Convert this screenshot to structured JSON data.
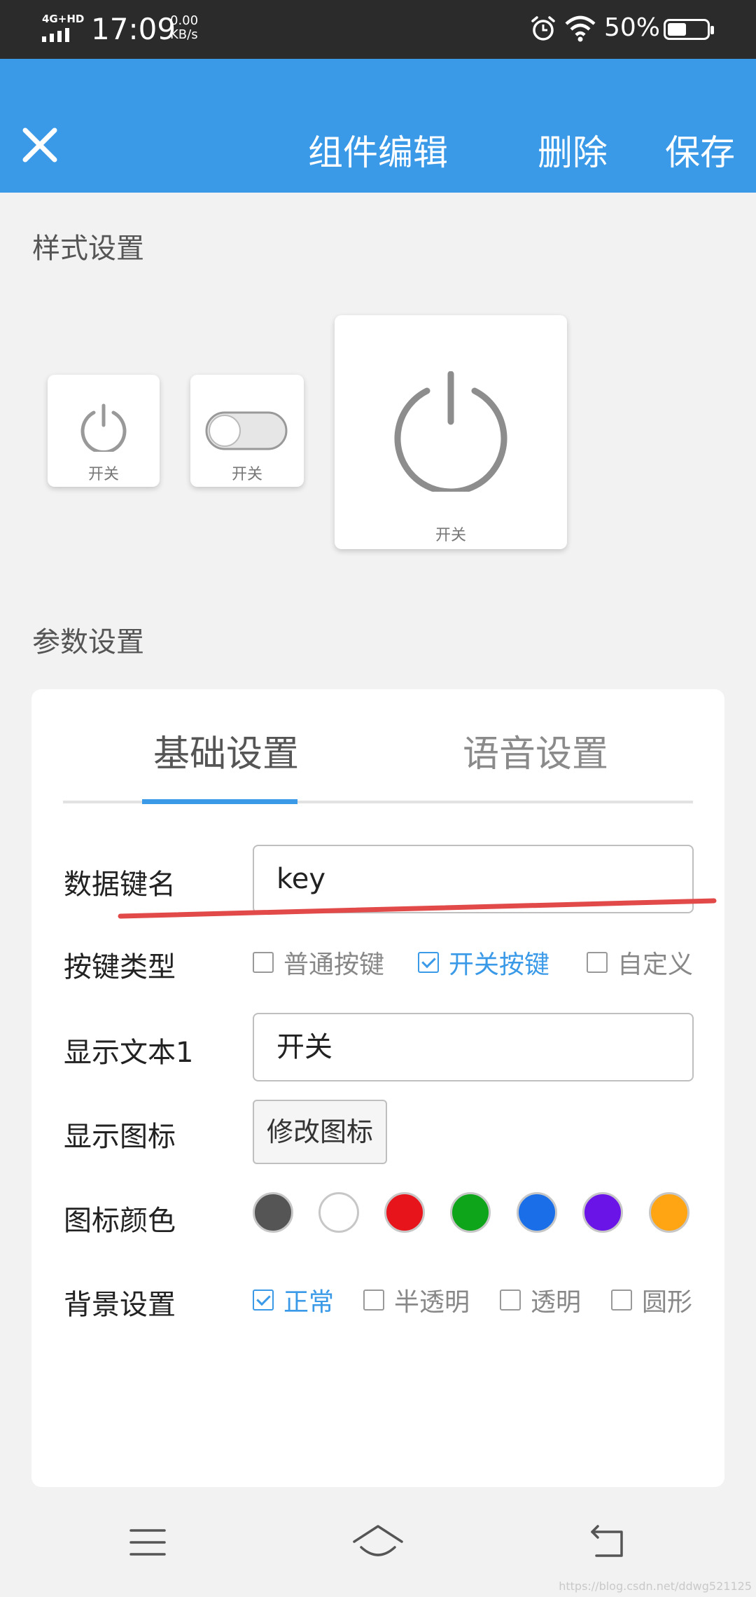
{
  "status_bar": {
    "network": "4G+HD",
    "time": "17:09",
    "speed_value": "0.00",
    "speed_unit": "KB/s",
    "battery_text": "50%",
    "battery_level": 0.5
  },
  "app_bar": {
    "close_icon": "close-icon",
    "title": "组件编辑",
    "delete_label": "删除",
    "save_label": "保存",
    "color": "#3a9ae8"
  },
  "style_section": {
    "title": "样式设置",
    "options": [
      {
        "icon": "power-icon",
        "caption": "开关"
      },
      {
        "icon": "toggle-switch-icon",
        "caption": "开关"
      },
      {
        "icon": "power-icon",
        "caption": "开关"
      }
    ]
  },
  "param_section": {
    "title": "参数设置",
    "tabs": [
      {
        "label": "基础设置",
        "active": true
      },
      {
        "label": "语音设置",
        "active": false
      }
    ],
    "data_key": {
      "label": "数据键名",
      "value": "key"
    },
    "key_type": {
      "label": "按键类型",
      "options": [
        {
          "label": "普通按键",
          "checked": false
        },
        {
          "label": "开关按键",
          "checked": true
        },
        {
          "label": "自定义",
          "checked": false
        }
      ]
    },
    "display_text": {
      "label": "显示文本1",
      "value": "开关"
    },
    "display_icon": {
      "label": "显示图标",
      "button_label": "修改图标"
    },
    "icon_color": {
      "label": "图标颜色",
      "colors": [
        "#555555",
        "#ffffff",
        "#e8141b",
        "#0fa51b",
        "#1a6fe8",
        "#6a14e8",
        "#ffa514"
      ]
    },
    "background": {
      "label": "背景设置",
      "options": [
        {
          "label": "正常",
          "checked": true
        },
        {
          "label": "半透明",
          "checked": false
        },
        {
          "label": "透明",
          "checked": false
        },
        {
          "label": "圆形",
          "checked": false
        }
      ]
    }
  },
  "nav_bar": {
    "buttons": [
      "menu-icon",
      "home-icon",
      "back-icon"
    ]
  },
  "watermark": "https://blog.csdn.net/ddwg521125"
}
